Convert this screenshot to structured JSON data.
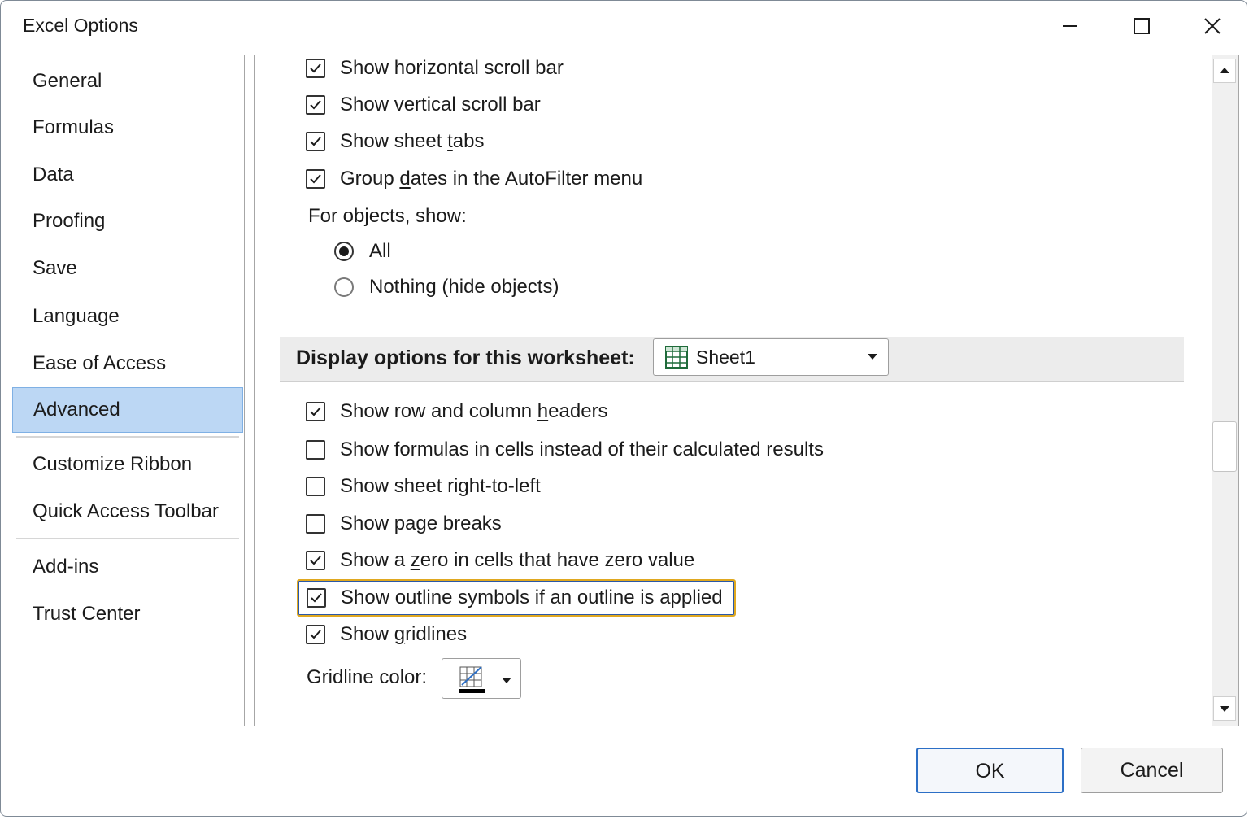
{
  "window": {
    "title": "Excel Options"
  },
  "nav": {
    "items": [
      {
        "label": "General",
        "selected": false
      },
      {
        "label": "Formulas",
        "selected": false
      },
      {
        "label": "Data",
        "selected": false
      },
      {
        "label": "Proofing",
        "selected": false
      },
      {
        "label": "Save",
        "selected": false
      },
      {
        "label": "Language",
        "selected": false
      },
      {
        "label": "Ease of Access",
        "selected": false
      },
      {
        "label": "Advanced",
        "selected": true
      },
      {
        "label": "Customize Ribbon",
        "selected": false
      },
      {
        "label": "Quick Access Toolbar",
        "selected": false
      },
      {
        "label": "Add-ins",
        "selected": false
      },
      {
        "label": "Trust Center",
        "selected": false
      }
    ]
  },
  "workbook_options": {
    "horizontal_scroll": {
      "pre": "Show ",
      "u": "h",
      "post": "orizontal scroll bar",
      "checked": true
    },
    "vertical_scroll": {
      "pre": "Show ",
      "u": "v",
      "post": "ertical scroll bar",
      "checked": true
    },
    "sheet_tabs": {
      "pre": "Show sheet ",
      "u": "t",
      "post": "abs",
      "checked": true
    },
    "group_dates": {
      "pre": "Group ",
      "u": "d",
      "post": "ates in the AutoFilter menu",
      "checked": true
    },
    "objects_label": "For objects, show:",
    "objects_all": {
      "label": "All",
      "checked": true
    },
    "objects_nothing": {
      "label": "Nothing (hide objects)",
      "checked": false
    }
  },
  "worksheet_section": {
    "title": "Display options for this worksheet:",
    "sheet_select": "Sheet1",
    "row_col_headers": {
      "pre": "Show row and column ",
      "u": "h",
      "post": "eaders",
      "checked": true
    },
    "formulas_in_cells": {
      "label": "Show formulas in cells instead of their calculated results",
      "checked": false
    },
    "right_to_left": {
      "label": "Show sheet right-to-left",
      "checked": false
    },
    "page_breaks": {
      "label": "Show page breaks",
      "checked": false
    },
    "zero_value": {
      "pre": "Show a ",
      "u": "z",
      "post": "ero in cells that have zero value",
      "checked": true
    },
    "outline_symbols": {
      "label": "Show outline symbols if an outline is applied",
      "checked": true
    },
    "gridlines": {
      "pre": "Show ",
      "u": "g",
      "post": "ridlines",
      "checked": true
    },
    "gridline_color_label": "Gridline color:"
  },
  "buttons": {
    "ok": "OK",
    "cancel": "Cancel"
  },
  "colors": {
    "selected_nav": "#bcd7f4",
    "focus_ring": "#e0a81f",
    "ok_border": "#2c6fc6"
  }
}
